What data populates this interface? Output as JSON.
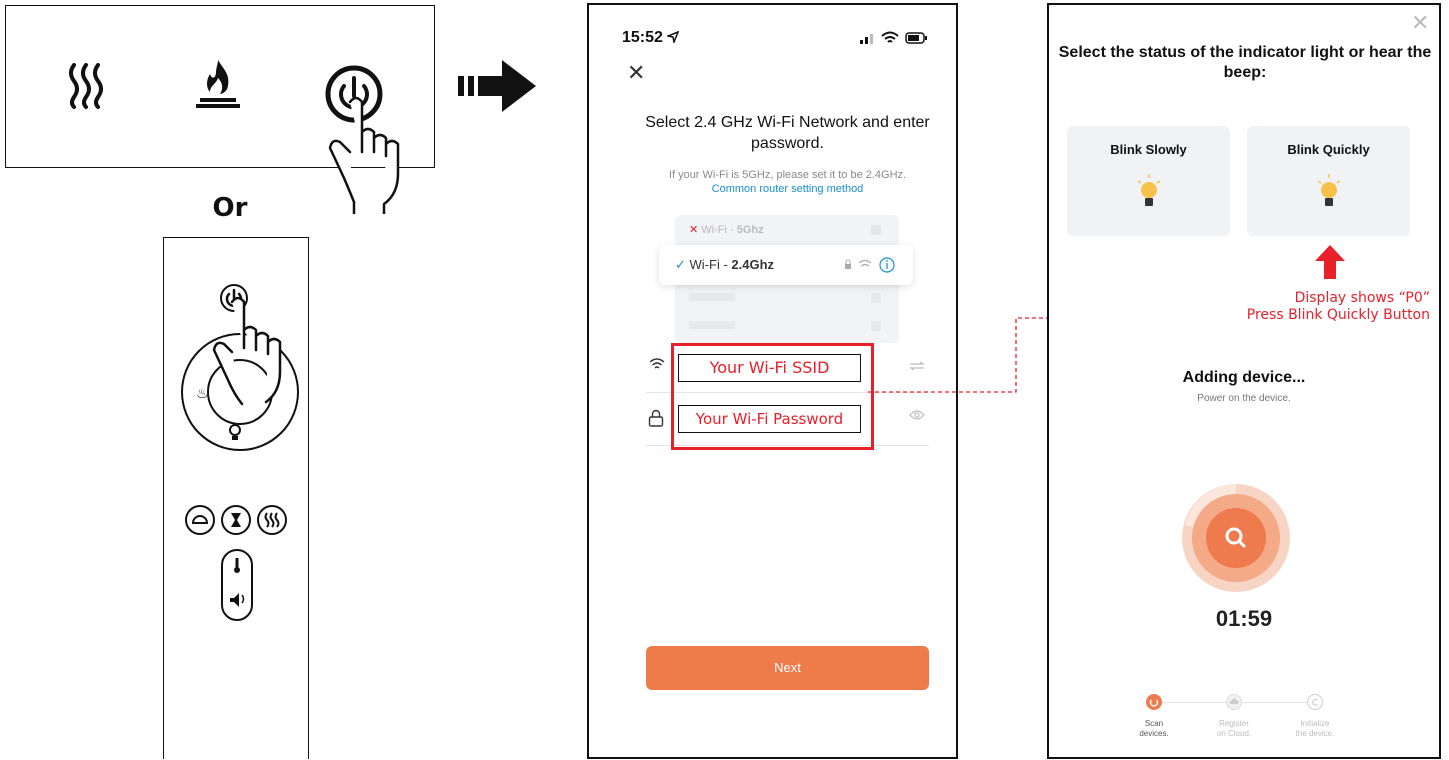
{
  "instructions": {
    "or_label": "Or",
    "control_panel_icons": [
      "heat-waves-icon",
      "flame-icon",
      "power-icon"
    ],
    "remote_icons": [
      "power-icon",
      "flame-icon",
      "bulb-icon",
      "speed-icon",
      "timer-icon",
      "heat-icon",
      "thermometer-icon",
      "volume-icon"
    ]
  },
  "phone1": {
    "status_time": "15:52",
    "title": "Select 2.4 GHz Wi-Fi Network and enter password.",
    "hint": "If your Wi-Fi is 5GHz, please set it to be 2.4GHz.",
    "hint_link": "Common router setting method",
    "wifi_options": [
      {
        "prefix": "Wi-Fi - ",
        "band": "5Ghz",
        "state": "invalid"
      },
      {
        "prefix": "Wi-Fi - ",
        "band": "2.4Ghz",
        "state": "valid"
      }
    ],
    "ssid_placeholder": "Your Wi-Fi SSID",
    "password_placeholder": "Your Wi-Fi Password",
    "next_label": "Next"
  },
  "phone2": {
    "title": "Select the status of the indicator light or hear the beep:",
    "blink_slowly": "Blink Slowly",
    "blink_quickly": "Blink Quickly",
    "note_line1": "Display shows “P0”",
    "note_line2": "Press Blink Quickly Button",
    "adding_title": "Adding device...",
    "adding_sub": "Power on the device.",
    "timer": "01:59",
    "steps": [
      {
        "label1": "Scan",
        "label2": "devices.",
        "active": true
      },
      {
        "label1": "Register",
        "label2": "on Cloud.",
        "active": false
      },
      {
        "label1": "Initialize",
        "label2": "the device.",
        "active": false
      }
    ]
  },
  "colors": {
    "accent_orange": "#f07b4a",
    "annotation_red": "#e8202a",
    "link_blue": "#1a8fd0"
  }
}
